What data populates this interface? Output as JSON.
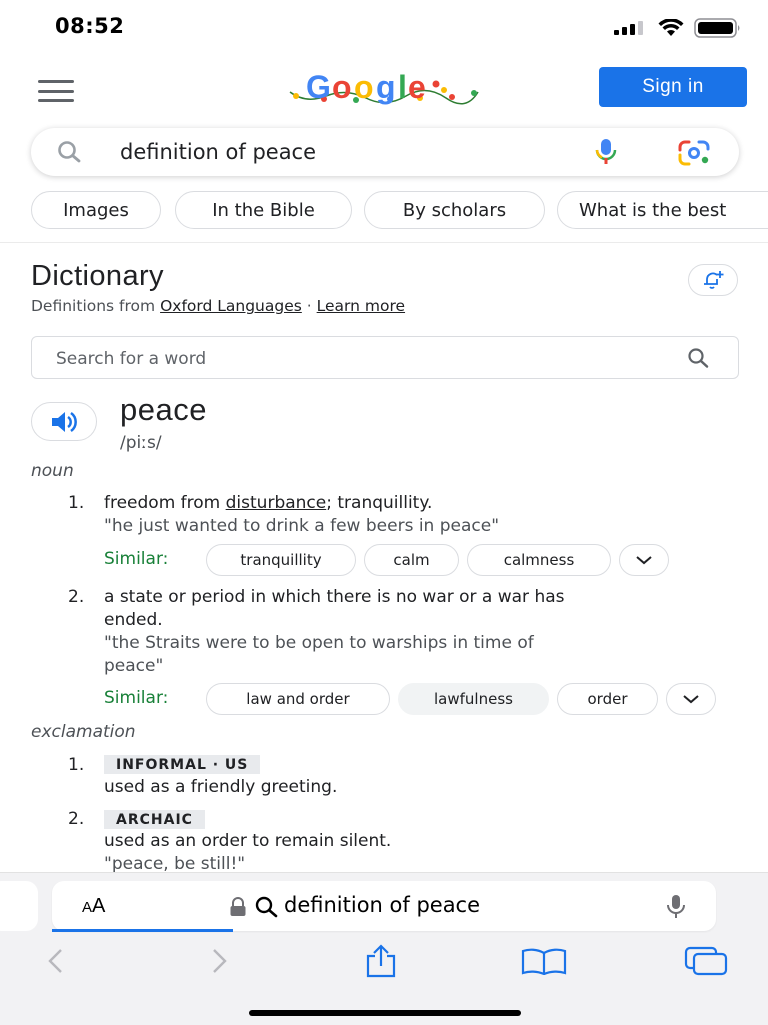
{
  "status_bar": {
    "time": "08:52"
  },
  "header": {
    "logo_alt": "Google",
    "sign_in_label": "Sign in"
  },
  "search": {
    "query": "definition of peace"
  },
  "chips": [
    "Images",
    "In the Bible",
    "By scholars",
    "What is the best"
  ],
  "dictionary": {
    "title": "Dictionary",
    "source_prefix": "Definitions from",
    "source_name": "Oxford Languages",
    "separator": "·",
    "learn_more": "Learn more",
    "word_search_placeholder": "Search for a word",
    "word": "peace",
    "phonetic": "/piːs/",
    "noun_label": "noun",
    "noun_senses": [
      {
        "number": "1.",
        "definition_parts": [
          "freedom from ",
          "disturbance",
          "; tranquillity."
        ],
        "example": "\"he just wanted to drink a few beers in peace\"",
        "similar_label": "Similar:",
        "similar": [
          "tranquillity",
          "calm",
          "calmness"
        ]
      },
      {
        "number": "2.",
        "definition_line1": "a state or period in which there is no war or a war has",
        "definition_line2": "ended.",
        "example_line1": "\"the Straits were to be open to warships in time of",
        "example_line2": "peace\"",
        "similar_label": "Similar:",
        "similar": [
          "law and order",
          "lawfulness",
          "order"
        ]
      }
    ],
    "exclamation_label": "exclamation",
    "exclamation_senses": [
      {
        "number": "1.",
        "label": "INFORMAL · US",
        "definition": "used as a friendly greeting."
      },
      {
        "number": "2.",
        "label": "ARCHAIC",
        "definition": "used as an order to remain silent.",
        "example": "\"peace, be still!\""
      }
    ]
  },
  "safari": {
    "aa_small": "A",
    "aa_large": "A",
    "url_text": "definition of peace",
    "accent": "#1a73e8"
  },
  "colors": {
    "google_blue": "#1a73e8",
    "similar_green": "#188038"
  }
}
